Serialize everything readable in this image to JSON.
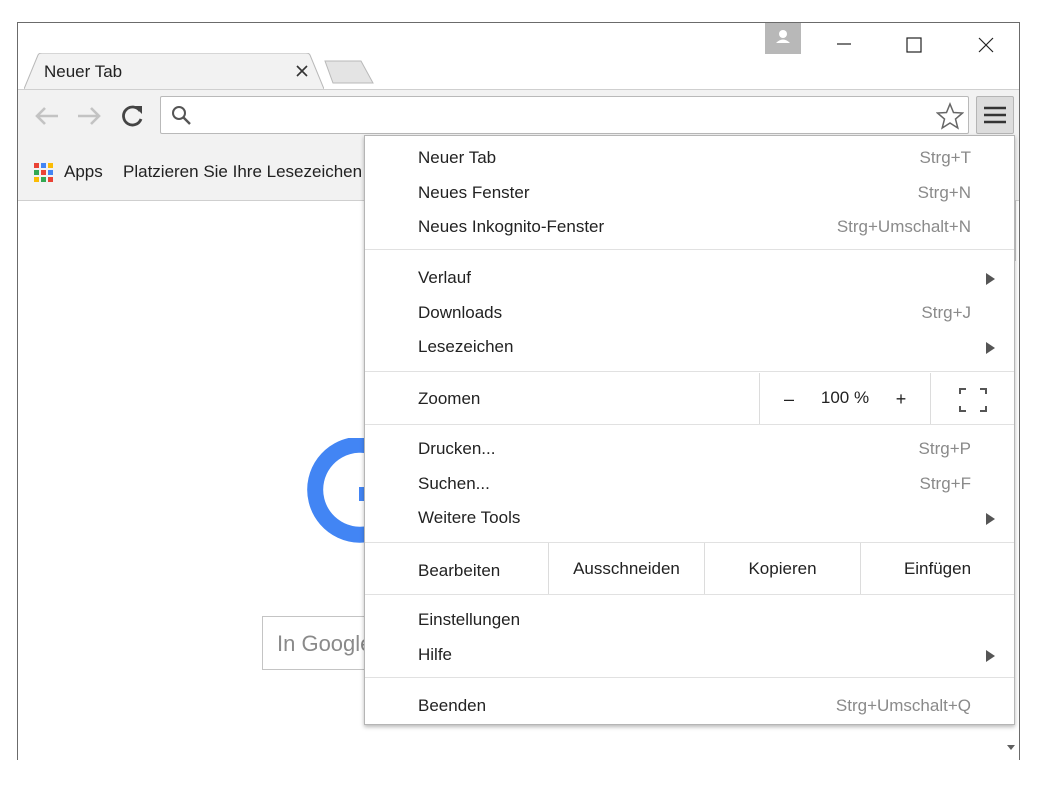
{
  "tabs": [
    {
      "title": "Neuer Tab"
    }
  ],
  "toolbar": {
    "omnibox_value": ""
  },
  "bookmarks_bar": {
    "apps_label": "Apps",
    "hint": "Platzieren Sie Ihre Lesezeichen"
  },
  "page": {
    "search_placeholder": "In Google suchen"
  },
  "menu": {
    "group1": [
      {
        "label": "Neuer Tab",
        "shortcut": "Strg+T"
      },
      {
        "label": "Neues Fenster",
        "shortcut": "Strg+N"
      },
      {
        "label": "Neues Inkognito-Fenster",
        "shortcut": "Strg+Umschalt+N"
      }
    ],
    "group2": [
      {
        "label": "Verlauf",
        "shortcut": ""
      },
      {
        "label": "Downloads",
        "shortcut": "Strg+J"
      },
      {
        "label": "Lesezeichen",
        "shortcut": ""
      }
    ],
    "zoom": {
      "label": "Zoomen",
      "minus": "–",
      "value": "100 %",
      "plus": "+"
    },
    "group3": [
      {
        "label": "Drucken...",
        "shortcut": "Strg+P"
      },
      {
        "label": "Suchen...",
        "shortcut": "Strg+F"
      },
      {
        "label": "Weitere Tools",
        "shortcut": ""
      }
    ],
    "edit": {
      "label": "Bearbeiten",
      "cut": "Ausschneiden",
      "copy": "Kopieren",
      "paste": "Einfügen"
    },
    "group4": [
      {
        "label": "Einstellungen",
        "shortcut": ""
      },
      {
        "label": "Hilfe",
        "shortcut": ""
      }
    ],
    "group5": [
      {
        "label": "Beenden",
        "shortcut": "Strg+Umschalt+Q"
      }
    ]
  },
  "icons": {
    "profile": "person-icon",
    "minimize": "minimize-icon",
    "maximize": "maximize-icon",
    "close": "close-icon",
    "back": "back-arrow-icon",
    "forward": "forward-arrow-icon",
    "reload": "reload-icon",
    "search": "search-icon",
    "bookmark": "star-icon",
    "menu": "hamburger-menu-icon",
    "apps": "apps-grid-icon",
    "fullscreen": "fullscreen-icon",
    "submenu": "submenu-arrow-icon"
  },
  "colors": {
    "google_blue": "#4285f4",
    "profile_bg": "#b8b8b8"
  }
}
